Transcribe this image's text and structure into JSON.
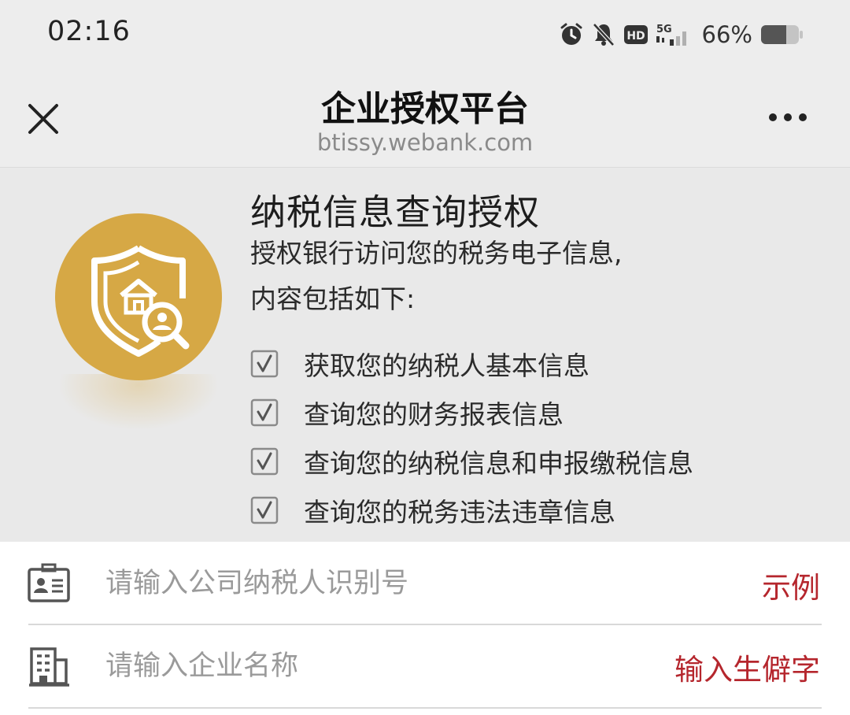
{
  "status_bar": {
    "time": "02:16",
    "network": "5G",
    "battery": "66%",
    "icons": [
      "alarm-icon",
      "mute-bell-icon",
      "hd-icon",
      "signal-5g-icon",
      "battery-icon"
    ]
  },
  "nav": {
    "title": "企业授权平台",
    "url": "btissy.webank.com",
    "close_icon": "close-icon",
    "more_icon": "more-icon"
  },
  "hero": {
    "title": "纳税信息查询授权",
    "desc_line1": "授权银行访问您的税务电子信息,",
    "desc_line2": "内容包括如下:",
    "badge_icon": "shield-enterprise-search-icon",
    "badge_color": "#d6a845",
    "items": [
      {
        "label": "获取您的纳税人基本信息",
        "checked": true
      },
      {
        "label": "查询您的财务报表信息",
        "checked": true
      },
      {
        "label": "查询您的纳税信息和申报缴税信息",
        "checked": true
      },
      {
        "label": "查询您的税务违法违章信息",
        "checked": true
      }
    ]
  },
  "form": {
    "tax_id": {
      "placeholder": "请输入公司纳税人识别号",
      "value": "",
      "action": "示例",
      "icon": "id-card-icon"
    },
    "company_name": {
      "placeholder": "请输入企业名称",
      "value": "",
      "action": "输入生僻字",
      "icon": "building-icon"
    },
    "action_color": "#b5262d"
  }
}
